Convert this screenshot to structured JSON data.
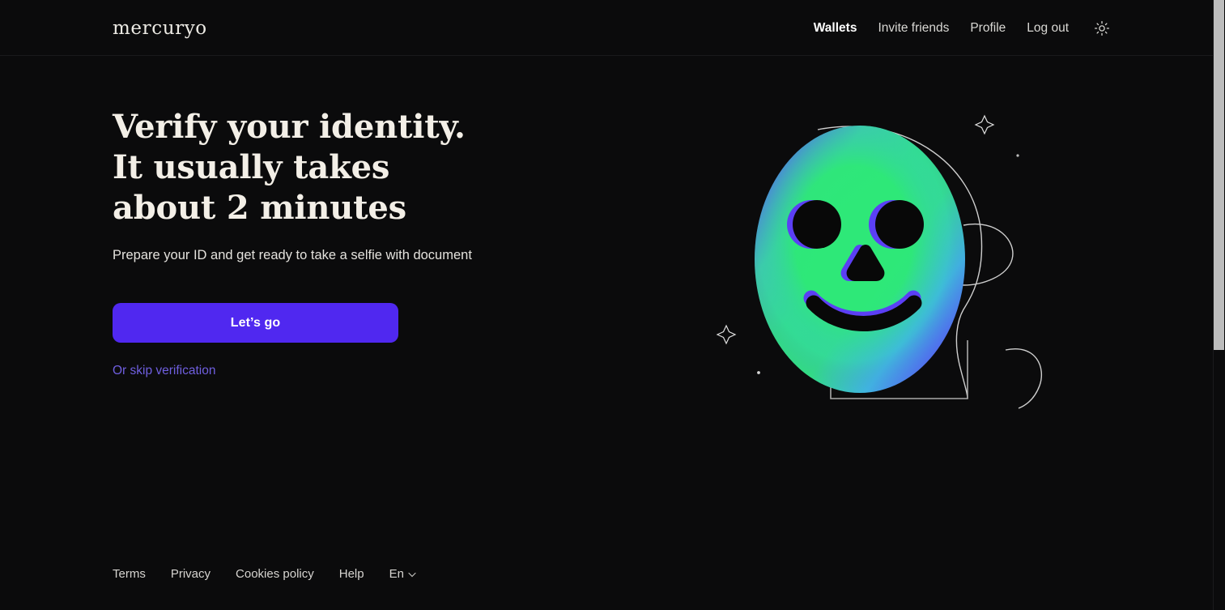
{
  "brand": {
    "logo_text": "mercuryo"
  },
  "header": {
    "nav": [
      {
        "label": "Wallets",
        "active": true
      },
      {
        "label": "Invite friends",
        "active": false
      },
      {
        "label": "Profile",
        "active": false
      },
      {
        "label": "Log out",
        "active": false
      }
    ],
    "theme_toggle_icon": "sun-icon"
  },
  "hero": {
    "title": "Verify your identity. It usually takes about 2 minutes",
    "subtitle": "Prepare your ID and get ready to take a selfie with document",
    "cta_label": "Let’s go",
    "skip_label": "Or skip verification"
  },
  "illustration": {
    "name": "face-scan-illustration",
    "face_gradient_edge": "#5b3ff5",
    "face_gradient_center": "#2ee878",
    "outline_color": "#cfcfcf",
    "decorations": [
      "sparkle-star",
      "sparkle-star",
      "dot",
      "dot",
      "arc"
    ]
  },
  "footer": {
    "links": [
      "Terms",
      "Privacy",
      "Cookies policy",
      "Help"
    ],
    "language": "En",
    "language_chevron": "chevron-down-icon"
  },
  "colors": {
    "background": "#0b0b0c",
    "accent": "#5028f0",
    "link_muted": "#6f5fe0",
    "text_primary": "#f3efe7"
  }
}
